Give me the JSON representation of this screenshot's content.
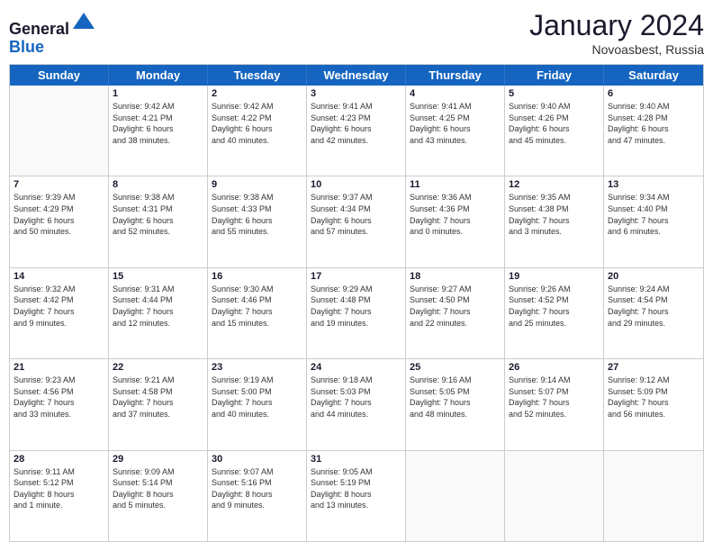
{
  "header": {
    "logo_line1": "General",
    "logo_line2": "Blue",
    "month": "January 2024",
    "location": "Novoasbest, Russia"
  },
  "days_of_week": [
    "Sunday",
    "Monday",
    "Tuesday",
    "Wednesday",
    "Thursday",
    "Friday",
    "Saturday"
  ],
  "weeks": [
    [
      {
        "day": "",
        "info": ""
      },
      {
        "day": "1",
        "info": "Sunrise: 9:42 AM\nSunset: 4:21 PM\nDaylight: 6 hours\nand 38 minutes."
      },
      {
        "day": "2",
        "info": "Sunrise: 9:42 AM\nSunset: 4:22 PM\nDaylight: 6 hours\nand 40 minutes."
      },
      {
        "day": "3",
        "info": "Sunrise: 9:41 AM\nSunset: 4:23 PM\nDaylight: 6 hours\nand 42 minutes."
      },
      {
        "day": "4",
        "info": "Sunrise: 9:41 AM\nSunset: 4:25 PM\nDaylight: 6 hours\nand 43 minutes."
      },
      {
        "day": "5",
        "info": "Sunrise: 9:40 AM\nSunset: 4:26 PM\nDaylight: 6 hours\nand 45 minutes."
      },
      {
        "day": "6",
        "info": "Sunrise: 9:40 AM\nSunset: 4:28 PM\nDaylight: 6 hours\nand 47 minutes."
      }
    ],
    [
      {
        "day": "7",
        "info": "Sunrise: 9:39 AM\nSunset: 4:29 PM\nDaylight: 6 hours\nand 50 minutes."
      },
      {
        "day": "8",
        "info": "Sunrise: 9:38 AM\nSunset: 4:31 PM\nDaylight: 6 hours\nand 52 minutes."
      },
      {
        "day": "9",
        "info": "Sunrise: 9:38 AM\nSunset: 4:33 PM\nDaylight: 6 hours\nand 55 minutes."
      },
      {
        "day": "10",
        "info": "Sunrise: 9:37 AM\nSunset: 4:34 PM\nDaylight: 6 hours\nand 57 minutes."
      },
      {
        "day": "11",
        "info": "Sunrise: 9:36 AM\nSunset: 4:36 PM\nDaylight: 7 hours\nand 0 minutes."
      },
      {
        "day": "12",
        "info": "Sunrise: 9:35 AM\nSunset: 4:38 PM\nDaylight: 7 hours\nand 3 minutes."
      },
      {
        "day": "13",
        "info": "Sunrise: 9:34 AM\nSunset: 4:40 PM\nDaylight: 7 hours\nand 6 minutes."
      }
    ],
    [
      {
        "day": "14",
        "info": "Sunrise: 9:32 AM\nSunset: 4:42 PM\nDaylight: 7 hours\nand 9 minutes."
      },
      {
        "day": "15",
        "info": "Sunrise: 9:31 AM\nSunset: 4:44 PM\nDaylight: 7 hours\nand 12 minutes."
      },
      {
        "day": "16",
        "info": "Sunrise: 9:30 AM\nSunset: 4:46 PM\nDaylight: 7 hours\nand 15 minutes."
      },
      {
        "day": "17",
        "info": "Sunrise: 9:29 AM\nSunset: 4:48 PM\nDaylight: 7 hours\nand 19 minutes."
      },
      {
        "day": "18",
        "info": "Sunrise: 9:27 AM\nSunset: 4:50 PM\nDaylight: 7 hours\nand 22 minutes."
      },
      {
        "day": "19",
        "info": "Sunrise: 9:26 AM\nSunset: 4:52 PM\nDaylight: 7 hours\nand 25 minutes."
      },
      {
        "day": "20",
        "info": "Sunrise: 9:24 AM\nSunset: 4:54 PM\nDaylight: 7 hours\nand 29 minutes."
      }
    ],
    [
      {
        "day": "21",
        "info": "Sunrise: 9:23 AM\nSunset: 4:56 PM\nDaylight: 7 hours\nand 33 minutes."
      },
      {
        "day": "22",
        "info": "Sunrise: 9:21 AM\nSunset: 4:58 PM\nDaylight: 7 hours\nand 37 minutes."
      },
      {
        "day": "23",
        "info": "Sunrise: 9:19 AM\nSunset: 5:00 PM\nDaylight: 7 hours\nand 40 minutes."
      },
      {
        "day": "24",
        "info": "Sunrise: 9:18 AM\nSunset: 5:03 PM\nDaylight: 7 hours\nand 44 minutes."
      },
      {
        "day": "25",
        "info": "Sunrise: 9:16 AM\nSunset: 5:05 PM\nDaylight: 7 hours\nand 48 minutes."
      },
      {
        "day": "26",
        "info": "Sunrise: 9:14 AM\nSunset: 5:07 PM\nDaylight: 7 hours\nand 52 minutes."
      },
      {
        "day": "27",
        "info": "Sunrise: 9:12 AM\nSunset: 5:09 PM\nDaylight: 7 hours\nand 56 minutes."
      }
    ],
    [
      {
        "day": "28",
        "info": "Sunrise: 9:11 AM\nSunset: 5:12 PM\nDaylight: 8 hours\nand 1 minute."
      },
      {
        "day": "29",
        "info": "Sunrise: 9:09 AM\nSunset: 5:14 PM\nDaylight: 8 hours\nand 5 minutes."
      },
      {
        "day": "30",
        "info": "Sunrise: 9:07 AM\nSunset: 5:16 PM\nDaylight: 8 hours\nand 9 minutes."
      },
      {
        "day": "31",
        "info": "Sunrise: 9:05 AM\nSunset: 5:19 PM\nDaylight: 8 hours\nand 13 minutes."
      },
      {
        "day": "",
        "info": ""
      },
      {
        "day": "",
        "info": ""
      },
      {
        "day": "",
        "info": ""
      }
    ]
  ]
}
